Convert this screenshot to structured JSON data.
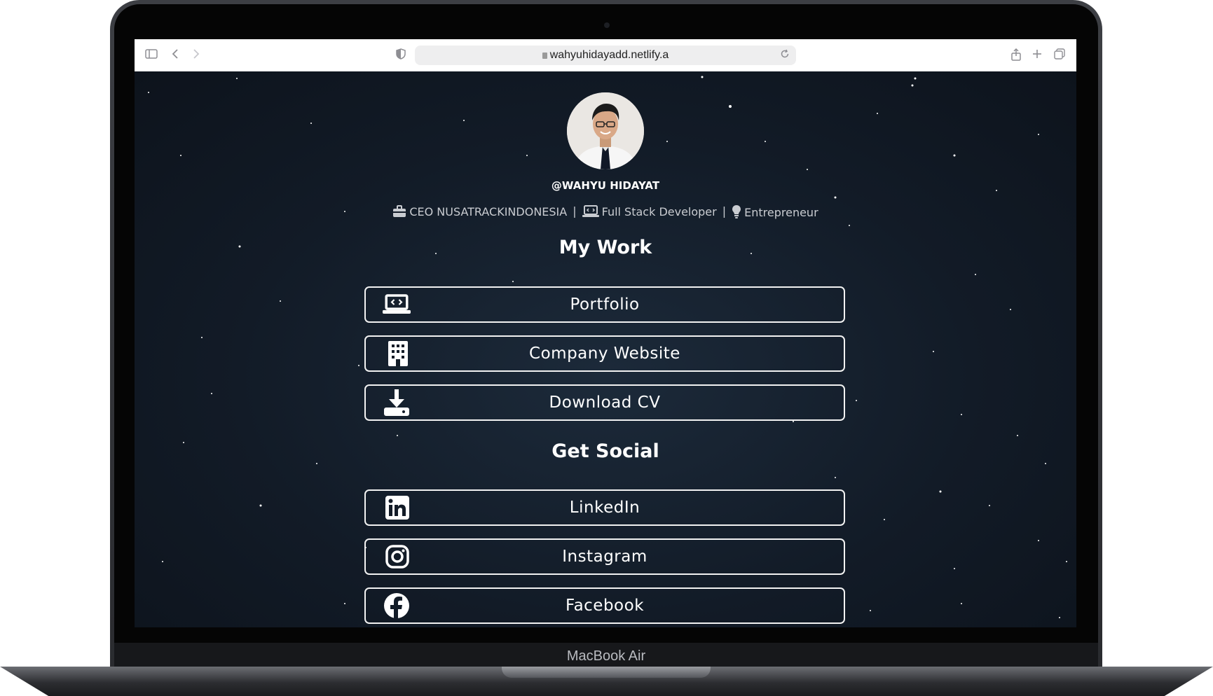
{
  "device": {
    "model_label": "MacBook Air"
  },
  "browser": {
    "url": "wahyuhidayadd.netlify.a",
    "icons": [
      "sidebar-icon",
      "back-icon",
      "forward-icon",
      "shield-icon",
      "reload-icon",
      "share-icon",
      "new-tab-icon",
      "tabs-overview-icon"
    ]
  },
  "profile": {
    "handle": "@WAHYU HIDAYAT",
    "roles": [
      {
        "icon": "briefcase-icon",
        "label": "CEO NUSATRACKINDONESIA"
      },
      {
        "icon": "laptop-code-icon",
        "label": "Full Stack Developer"
      },
      {
        "icon": "lightbulb-icon",
        "label": "Entrepreneur"
      }
    ],
    "separator": "|"
  },
  "my_work": {
    "title": "My Work",
    "links": [
      {
        "icon": "laptop-code-icon",
        "label": "Portfolio"
      },
      {
        "icon": "building-icon",
        "label": "Company Website"
      },
      {
        "icon": "download-icon",
        "label": "Download CV"
      }
    ]
  },
  "get_social": {
    "title": "Get Social",
    "links": [
      {
        "icon": "linkedin-icon",
        "label": "LinkedIn"
      },
      {
        "icon": "instagram-icon",
        "label": "Instagram"
      },
      {
        "icon": "facebook-icon",
        "label": "Facebook"
      }
    ]
  },
  "colors": {
    "background": "#121b27",
    "button_border": "#f2f2f2",
    "text": "#ffffff",
    "tagline": "#c9ccd1"
  }
}
